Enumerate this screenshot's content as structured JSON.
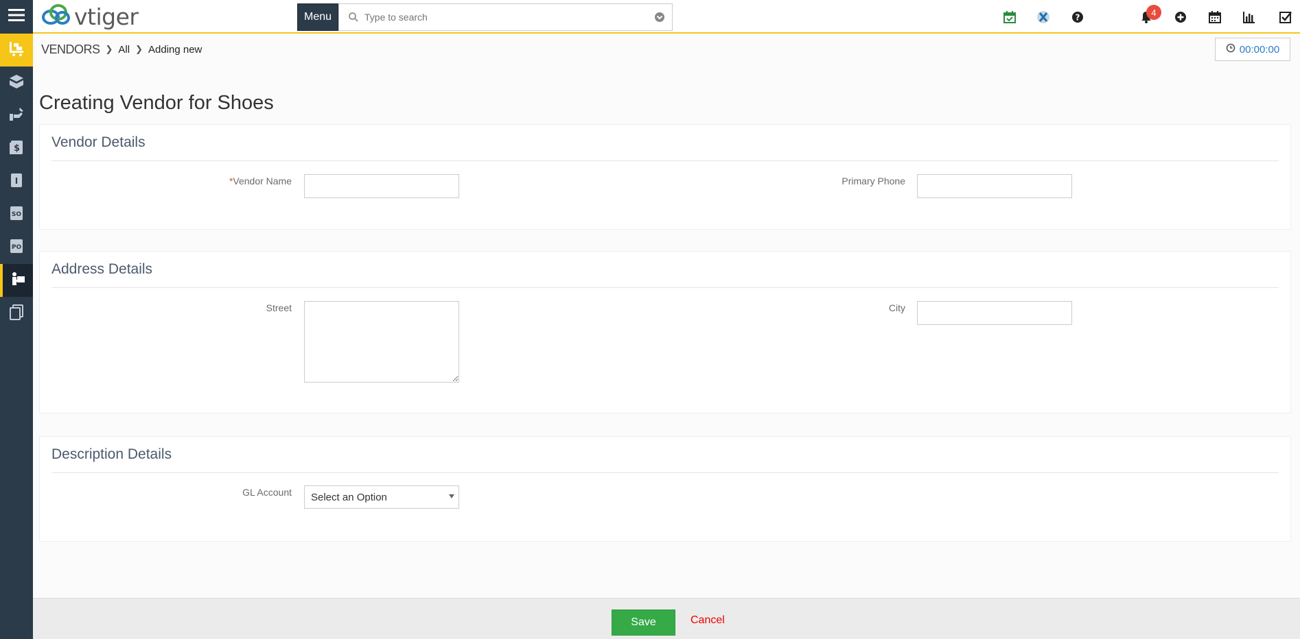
{
  "app": {
    "logo_text": "vtiger",
    "brand_color": "#f5c518",
    "rail_color": "#2c3b49"
  },
  "header": {
    "menu_label": "Menu",
    "search_placeholder": "Type to search",
    "notification_count": "4",
    "icons": [
      "calendar-check-icon",
      "xm-icon",
      "help-icon",
      "bell-icon",
      "plus-circle-icon",
      "calendar-icon",
      "reports-icon",
      "tasks-icon",
      "user-icon"
    ]
  },
  "sidebar": {
    "items": [
      "hamburger-icon",
      "inventory-icon",
      "products-icon",
      "services-icon",
      "price-book-icon",
      "invoice-icon",
      "sales-order-icon",
      "purchase-order-icon",
      "vendors-icon",
      "documents-icon"
    ]
  },
  "breadcrumb": {
    "module": "VENDORS",
    "all": "All",
    "current": "Adding new"
  },
  "timer": "00:00:00",
  "page_title": "Creating Vendor for Shoes",
  "sections": {
    "vendor": {
      "title": "Vendor Details",
      "vendor_name_required": "*",
      "vendor_name_label": "Vendor Name",
      "vendor_name_value": "",
      "primary_phone_label": "Primary Phone",
      "primary_phone_value": ""
    },
    "address": {
      "title": "Address Details",
      "street_label": "Street",
      "street_value": "",
      "city_label": "City",
      "city_value": ""
    },
    "description": {
      "title": "Description Details",
      "gl_account_label": "GL Account",
      "gl_account_value": "Select an Option"
    }
  },
  "footer": {
    "save_label": "Save",
    "cancel_label": "Cancel"
  }
}
